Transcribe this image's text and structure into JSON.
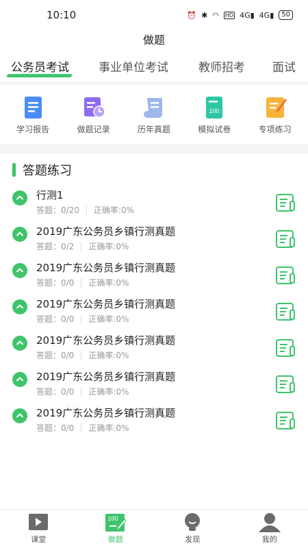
{
  "status": {
    "time": "10:10",
    "network": "HD",
    "signal1": "4G",
    "signal2": "4G",
    "battery": "50"
  },
  "header": {
    "title": "做题"
  },
  "tabs": [
    {
      "label": "公务员考试",
      "active": true
    },
    {
      "label": "事业单位考试",
      "active": false
    },
    {
      "label": "教师招考",
      "active": false
    },
    {
      "label": "面试",
      "active": false
    }
  ],
  "categories": [
    {
      "label": "学习报告",
      "icon": "study-report-icon"
    },
    {
      "label": "做题记录",
      "icon": "practice-record-icon"
    },
    {
      "label": "历年真题",
      "icon": "past-papers-icon"
    },
    {
      "label": "模拟试卷",
      "icon": "mock-exam-icon"
    },
    {
      "label": "专项练习",
      "icon": "special-practice-icon"
    }
  ],
  "section": {
    "title": "答题练习"
  },
  "items": [
    {
      "name": "行测1",
      "answered": "答题：0/20",
      "accuracy": "正确率:0%"
    },
    {
      "name": "2019广东公务员乡镇行测真题",
      "answered": "答题：0/2",
      "accuracy": "正确率:0%"
    },
    {
      "name": "2019广东公务员乡镇行测真题",
      "answered": "答题：0/0",
      "accuracy": "正确率:0%"
    },
    {
      "name": "2019广东公务员乡镇行测真题",
      "answered": "答题：0/0",
      "accuracy": "正确率:0%"
    },
    {
      "name": "2019广东公务员乡镇行测真题",
      "answered": "答题：0/0",
      "accuracy": "正确率:0%"
    },
    {
      "name": "2019广东公务员乡镇行测真题",
      "answered": "答题：0/0",
      "accuracy": "正确率:0%"
    },
    {
      "name": "2019广东公务员乡镇行测真题",
      "answered": "答题：0/0",
      "accuracy": "正确率:0%"
    }
  ],
  "bottom_nav": [
    {
      "label": "课堂",
      "active": false
    },
    {
      "label": "做题",
      "active": true
    },
    {
      "label": "发现",
      "active": false
    },
    {
      "label": "我的",
      "active": false
    }
  ],
  "colors": {
    "accent": "#3fc46b",
    "inactive": "#555555"
  }
}
